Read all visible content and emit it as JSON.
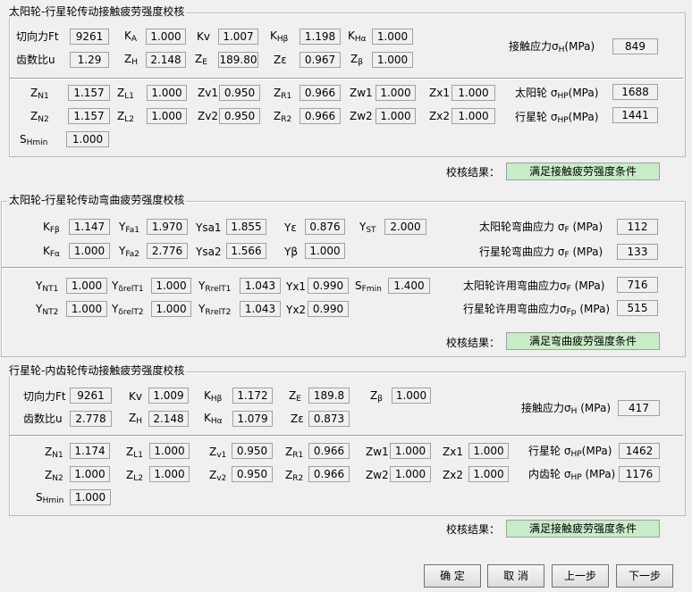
{
  "g1": {
    "title": "太阳轮-行星轮传动接触疲劳强度校核",
    "Ft_label": "切向力Ft",
    "Ft": "9261",
    "KA": "1.000",
    "Kv": "1.007",
    "KHb": "1.198",
    "KHa": "1.000",
    "u_label": "齿数比u",
    "u": "1.29",
    "ZH": "2.148",
    "ZE": "189.80",
    "Ze": "0.967",
    "Zb": "1.000",
    "sigmaH_label": "接触应力",
    "sigmaH": "849",
    "ZN1": "1.157",
    "ZL1": "1.000",
    "Zv1": "0.950",
    "ZR1": "0.966",
    "Zw1": "1.000",
    "Zx1": "1.000",
    "ZN2": "1.157",
    "ZL2": "1.000",
    "Zv2": "0.950",
    "ZR2": "0.966",
    "Zw2": "1.000",
    "Zx2": "1.000",
    "sun_label": "太阳轮",
    "sun_HP": "1688",
    "planet_label": "行星轮",
    "planet_HP": "1441",
    "SHmin": "1.000",
    "result_label": "校核结果：",
    "result": "满足接触疲劳强度条件"
  },
  "g2": {
    "title": "太阳轮-行星轮传动弯曲疲劳强度校核",
    "KFb": "1.147",
    "YFa1": "1.970",
    "Ysa1": "1.855",
    "Ye": "0.876",
    "YST": "2.000",
    "KFa": "1.000",
    "YFa2": "2.776",
    "Ysa2": "1.566",
    "Yb": "1.000",
    "sun_F_label": "太阳轮弯曲应力",
    "sun_F": "112",
    "planet_F_label": "行星轮弯曲应力",
    "planet_F": "133",
    "YNT1": "1.000",
    "YdrelT1": "1.000",
    "YRrelT1": "1.043",
    "Yx1": "0.990",
    "SFmin": "1.400",
    "YNT2": "1.000",
    "YdrelT2": "1.000",
    "YRrelT2": "1.043",
    "Yx2": "0.990",
    "sun_FP_label": "太阳轮许用弯曲应力",
    "sun_FP": "716",
    "planet_FP_label": "行星轮许用弯曲应力",
    "planet_FP": "515",
    "result_label": "校核结果：",
    "result": "满足弯曲疲劳强度条件"
  },
  "g3": {
    "title": "行星轮-内齿轮传动接触疲劳强度校核",
    "Ft_label": "切向力Ft",
    "Ft": "9261",
    "Kv": "1.009",
    "KHb": "1.172",
    "ZE": "189.8",
    "Zb": "1.000",
    "u_label": "齿数比u",
    "u": "2.778",
    "ZH": "2.148",
    "KHa": "1.079",
    "Ze": "0.873",
    "sigmaH_label": "接触应力",
    "sigmaH": "417",
    "ZN1": "1.174",
    "ZL1": "1.000",
    "Zv1": "0.950",
    "ZR1": "0.966",
    "Zw1": "1.000",
    "Zx1": "1.000",
    "ZN2": "1.000",
    "ZL2": "1.000",
    "Zv2": "0.950",
    "ZR2": "0.966",
    "Zw2": "1.000",
    "Zx2": "1.000",
    "planet_label": "行星轮",
    "planet_HP": "1462",
    "ring_label": "内齿轮",
    "ring_HP": "1176",
    "SHmin": "1.000",
    "result_label": "校核结果：",
    "result": "满足接触疲劳强度条件"
  },
  "units": {
    "mpa": "(MPa)"
  },
  "buttons": {
    "ok": "确 定",
    "cancel": "取 消",
    "prev": "上一步",
    "next": "下一步"
  }
}
